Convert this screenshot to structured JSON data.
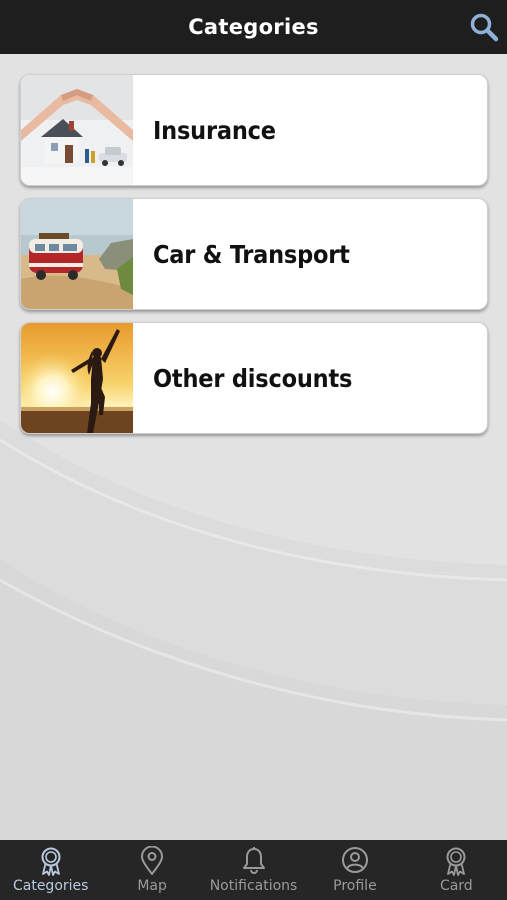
{
  "header": {
    "title": "Categories",
    "search_icon": "search-icon"
  },
  "categories": [
    {
      "label": "Insurance",
      "image": "house-under-hands-photo"
    },
    {
      "label": "Car & Transport",
      "image": "camper-van-beach-photo"
    },
    {
      "label": "Other discounts",
      "image": "sunset-beach-woman-photo"
    }
  ],
  "tabs": [
    {
      "label": "Categories",
      "icon": "award-ribbon-icon",
      "active": true
    },
    {
      "label": "Map",
      "icon": "map-pin-icon",
      "active": false
    },
    {
      "label": "Notifications",
      "icon": "bell-icon",
      "active": false
    },
    {
      "label": "Profile",
      "icon": "user-circle-icon",
      "active": false
    },
    {
      "label": "Card",
      "icon": "award-ribbon-icon",
      "active": false
    }
  ],
  "colors": {
    "topbar": "#1e1e1e",
    "background": "#e2e2e2",
    "tabbar": "#262626",
    "active_tab": "#b8c9e0",
    "inactive_tab": "#9a9a9a",
    "search_icon": "#8fb0d8"
  }
}
